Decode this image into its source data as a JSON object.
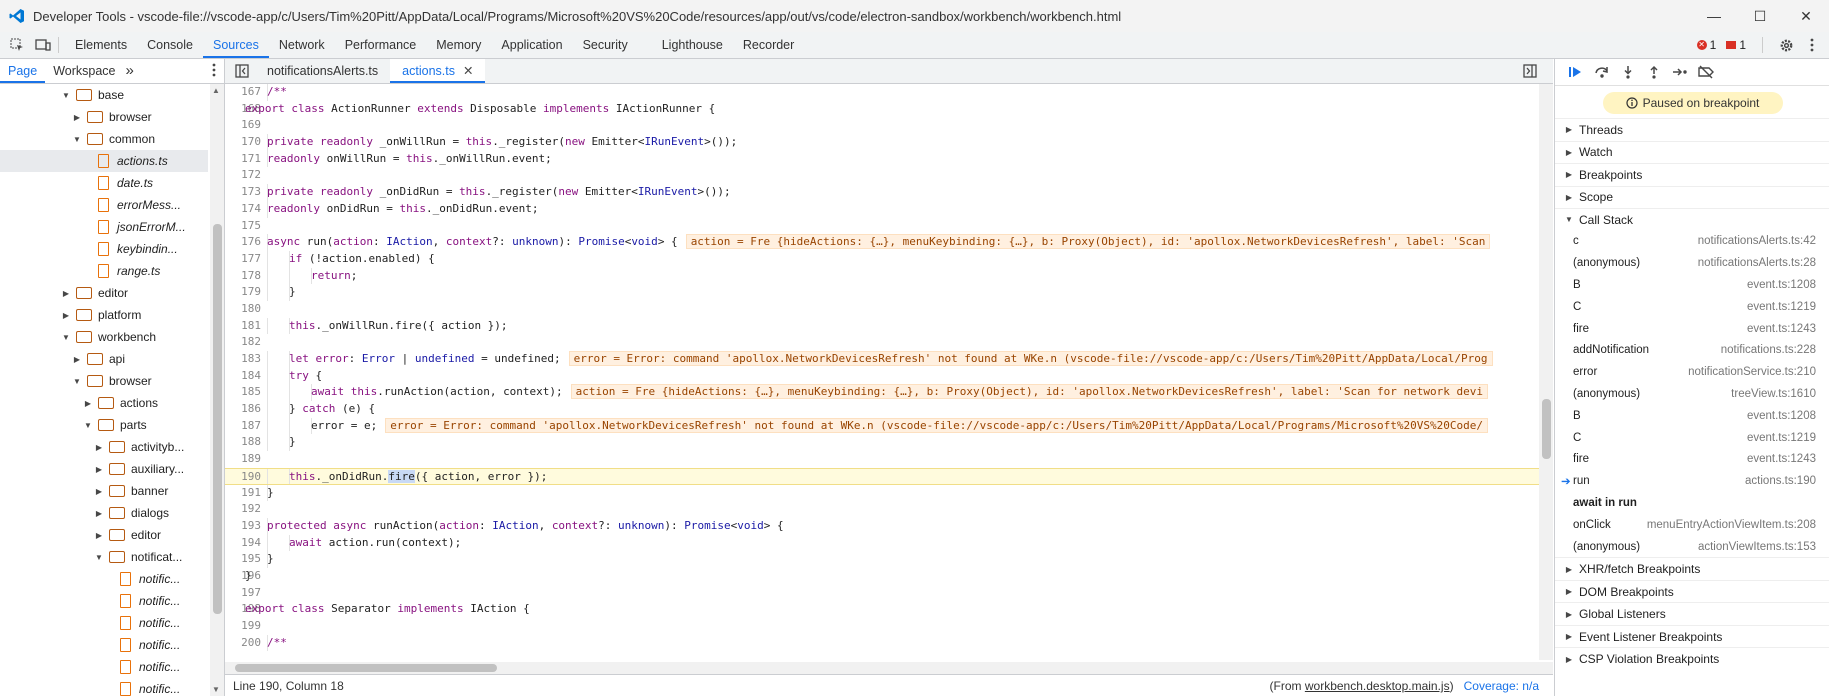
{
  "window": {
    "title": "Developer Tools - vscode-file://vscode-app/c/Users/Tim%20Pitt/AppData/Local/Programs/Microsoft%20VS%20Code/resources/app/out/vs/code/electron-sandbox/workbench/workbench.html",
    "minimize": "—",
    "maximize": "☐",
    "close": "✕"
  },
  "panel_tabs": [
    "Elements",
    "Console",
    "Sources",
    "Network",
    "Performance",
    "Memory",
    "Application",
    "Security",
    "Lighthouse",
    "Recorder"
  ],
  "badges": {
    "errors": "1",
    "issues": "1"
  },
  "navigator": {
    "tabs": [
      "Page",
      "Workspace"
    ],
    "more": "»",
    "tree": [
      {
        "label": "base",
        "type": "folder",
        "open": true,
        "depth": 0
      },
      {
        "label": "browser",
        "type": "folder",
        "open": false,
        "depth": 1
      },
      {
        "label": "common",
        "type": "folder",
        "open": true,
        "depth": 1
      },
      {
        "label": "actions.ts",
        "type": "file",
        "depth": 2,
        "selected": true
      },
      {
        "label": "date.ts",
        "type": "file",
        "depth": 2
      },
      {
        "label": "errorMess...",
        "type": "file",
        "depth": 2
      },
      {
        "label": "jsonErrorM...",
        "type": "file",
        "depth": 2
      },
      {
        "label": "keybindin...",
        "type": "file",
        "depth": 2
      },
      {
        "label": "range.ts",
        "type": "file",
        "depth": 2
      },
      {
        "label": "editor",
        "type": "folder",
        "open": false,
        "depth": 0
      },
      {
        "label": "platform",
        "type": "folder",
        "open": false,
        "depth": 0
      },
      {
        "label": "workbench",
        "type": "folder",
        "open": true,
        "depth": 0
      },
      {
        "label": "api",
        "type": "folder",
        "open": false,
        "depth": 1
      },
      {
        "label": "browser",
        "type": "folder",
        "open": true,
        "depth": 1
      },
      {
        "label": "actions",
        "type": "folder",
        "open": false,
        "depth": 2
      },
      {
        "label": "parts",
        "type": "folder",
        "open": true,
        "depth": 2
      },
      {
        "label": "activityb...",
        "type": "folder",
        "open": false,
        "depth": 3
      },
      {
        "label": "auxiliary...",
        "type": "folder",
        "open": false,
        "depth": 3
      },
      {
        "label": "banner",
        "type": "folder",
        "open": false,
        "depth": 3
      },
      {
        "label": "dialogs",
        "type": "folder",
        "open": false,
        "depth": 3
      },
      {
        "label": "editor",
        "type": "folder",
        "open": false,
        "depth": 3
      },
      {
        "label": "notificat...",
        "type": "folder",
        "open": true,
        "depth": 3
      },
      {
        "label": "notific...",
        "type": "file",
        "depth": 4
      },
      {
        "label": "notific...",
        "type": "file",
        "depth": 4
      },
      {
        "label": "notific...",
        "type": "file",
        "depth": 4
      },
      {
        "label": "notific...",
        "type": "file",
        "depth": 4
      },
      {
        "label": "notific...",
        "type": "file",
        "depth": 4
      },
      {
        "label": "notific...",
        "type": "file",
        "depth": 4
      }
    ]
  },
  "editor": {
    "tabs": [
      {
        "label": "notificationsAlerts.ts",
        "active": false
      },
      {
        "label": "actions.ts",
        "active": true,
        "close": "✕"
      }
    ],
    "lines": [
      {
        "n": "167",
        "indent": 1,
        "html": "<span class=\"kw\">/**</span>"
      },
      {
        "n": "168",
        "indent": 0,
        "html": "<span class=\"kw\">export class</span> ActionRunner <span class=\"kw\">extends</span> Disposable <span class=\"kw\">implements</span> IActionRunner {"
      },
      {
        "n": "169",
        "indent": 0,
        "html": ""
      },
      {
        "n": "170",
        "indent": 1,
        "html": "<span class=\"kw\">private readonly</span> _onWillRun = <span class=\"kw\">this</span>._register(<span class=\"kw\">new</span> Emitter&lt;<span class=\"ty\">IRunEvent</span>&gt;());"
      },
      {
        "n": "171",
        "indent": 1,
        "html": "<span class=\"kw\">readonly</span> onWillRun = <span class=\"kw\">this</span>._onWillRun.event;"
      },
      {
        "n": "172",
        "indent": 0,
        "html": ""
      },
      {
        "n": "173",
        "indent": 1,
        "html": "<span class=\"kw\">private readonly</span> _onDidRun = <span class=\"kw\">this</span>._register(<span class=\"kw\">new</span> Emitter&lt;<span class=\"ty\">IRunEvent</span>&gt;());"
      },
      {
        "n": "174",
        "indent": 1,
        "html": "<span class=\"kw\">readonly</span> onDidRun = <span class=\"kw\">this</span>._onDidRun.event;"
      },
      {
        "n": "175",
        "indent": 0,
        "html": ""
      },
      {
        "n": "176",
        "indent": 1,
        "html": "<span class=\"kw\">async</span> run(<span class=\"kw\">action</span>: <span class=\"ty\">IAction</span>, <span class=\"kw\">context</span>?: <span class=\"ty\">unknown</span>): <span class=\"ty\">Promise</span>&lt;<span class=\"ty\">void</span>&gt; {<span class=\"inl\">action = Fre {hideActions: {…}, menuKeybinding: {…}, b: Proxy(Object), id: 'apollox.NetworkDevicesRefresh', label: 'Scan</span>"
      },
      {
        "n": "177",
        "indent": 2,
        "html": "<span class=\"kw\">if</span> (!action.enabled) {"
      },
      {
        "n": "178",
        "indent": 3,
        "html": "<span class=\"kw\">return</span>;"
      },
      {
        "n": "179",
        "indent": 2,
        "html": "}"
      },
      {
        "n": "180",
        "indent": 0,
        "html": ""
      },
      {
        "n": "181",
        "indent": 2,
        "html": "<span class=\"kw\">this</span>._onWillRun.fire({ action });"
      },
      {
        "n": "182",
        "indent": 0,
        "html": ""
      },
      {
        "n": "183",
        "indent": 2,
        "html": "<span class=\"kw\">let</span> <span class=\"kw\">error</span>: <span class=\"ty\">Error</span> | <span class=\"ty\">undefined</span> = undefined;<span class=\"inl\">error = Error: command 'apollox.NetworkDevicesRefresh' not found at WKe.n (vscode-file://vscode-app/c:/Users/Tim%20Pitt/AppData/Local/Prog</span>"
      },
      {
        "n": "184",
        "indent": 2,
        "html": "<span class=\"kw\">try</span> {"
      },
      {
        "n": "185",
        "indent": 3,
        "html": "<span class=\"kw\">await this</span>.runAction(action, context);<span class=\"inl\">action = Fre {hideActions: {…}, menuKeybinding: {…}, b: Proxy(Object), id: 'apollox.NetworkDevicesRefresh', label: 'Scan for network devi</span>"
      },
      {
        "n": "186",
        "indent": 2,
        "html": "} <span class=\"kw\">catch</span> (e) {"
      },
      {
        "n": "187",
        "indent": 3,
        "html": "error = e;<span class=\"inl\">error = Error: command 'apollox.NetworkDevicesRefresh' not found at WKe.n (vscode-file://vscode-app/c:/Users/Tim%20Pitt/AppData/Local/Programs/Microsoft%20VS%20Code/</span>"
      },
      {
        "n": "188",
        "indent": 2,
        "html": "}"
      },
      {
        "n": "189",
        "indent": 0,
        "html": ""
      },
      {
        "n": "190",
        "indent": 2,
        "html": "<span class=\"kw\">this</span>._onDidRun.<span class=\"sel\">fire</span>({ action, error });",
        "hl": true
      },
      {
        "n": "191",
        "indent": 1,
        "html": "}"
      },
      {
        "n": "192",
        "indent": 0,
        "html": ""
      },
      {
        "n": "193",
        "indent": 1,
        "html": "<span class=\"kw\">protected async</span> runAction(<span class=\"kw\">action</span>: <span class=\"ty\">IAction</span>, <span class=\"kw\">context</span>?: <span class=\"ty\">unknown</span>): <span class=\"ty\">Promise</span>&lt;<span class=\"ty\">void</span>&gt; {"
      },
      {
        "n": "194",
        "indent": 2,
        "html": "<span class=\"kw\">await</span> action.run(context);"
      },
      {
        "n": "195",
        "indent": 1,
        "html": "}"
      },
      {
        "n": "196",
        "indent": 0,
        "html": "}"
      },
      {
        "n": "197",
        "indent": 0,
        "html": ""
      },
      {
        "n": "198",
        "indent": 0,
        "html": "<span class=\"kw\">export class</span> Separator <span class=\"kw\">implements</span> IAction {"
      },
      {
        "n": "199",
        "indent": 0,
        "html": ""
      },
      {
        "n": "200",
        "indent": 1,
        "html": "<span class=\"kw\">/**</span>"
      }
    ],
    "status": {
      "position": "Line 190, Column 18",
      "from_prefix": "(From ",
      "from_link": "workbench.desktop.main.js",
      "from_suffix": ")",
      "coverage": "Coverage: n/a"
    }
  },
  "debugger": {
    "paused": "Paused on breakpoint",
    "sections_top": [
      "Threads",
      "Watch",
      "Breakpoints",
      "Scope"
    ],
    "call_stack_label": "Call Stack",
    "frames": [
      {
        "name": "c",
        "loc": "notificationsAlerts.ts:42"
      },
      {
        "name": "(anonymous)",
        "loc": "notificationsAlerts.ts:28"
      },
      {
        "name": "B",
        "loc": "event.ts:1208"
      },
      {
        "name": "C",
        "loc": "event.ts:1219"
      },
      {
        "name": "fire",
        "loc": "event.ts:1243"
      },
      {
        "name": "addNotification",
        "loc": "notifications.ts:228"
      },
      {
        "name": "error",
        "loc": "notificationService.ts:210"
      },
      {
        "name": "(anonymous)",
        "loc": "treeView.ts:1610"
      },
      {
        "name": "B",
        "loc": "event.ts:1208"
      },
      {
        "name": "C",
        "loc": "event.ts:1219"
      },
      {
        "name": "fire",
        "loc": "event.ts:1243"
      },
      {
        "name": "run",
        "loc": "actions.ts:190",
        "current": true
      },
      {
        "name": "await in run",
        "loc": "",
        "async": true
      },
      {
        "name": "onClick",
        "loc": "menuEntryActionViewItem.ts:208"
      },
      {
        "name": "(anonymous)",
        "loc": "actionViewItems.ts:153"
      }
    ],
    "sections_bottom": [
      "XHR/fetch Breakpoints",
      "DOM Breakpoints",
      "Global Listeners",
      "Event Listener Breakpoints",
      "CSP Violation Breakpoints"
    ]
  }
}
